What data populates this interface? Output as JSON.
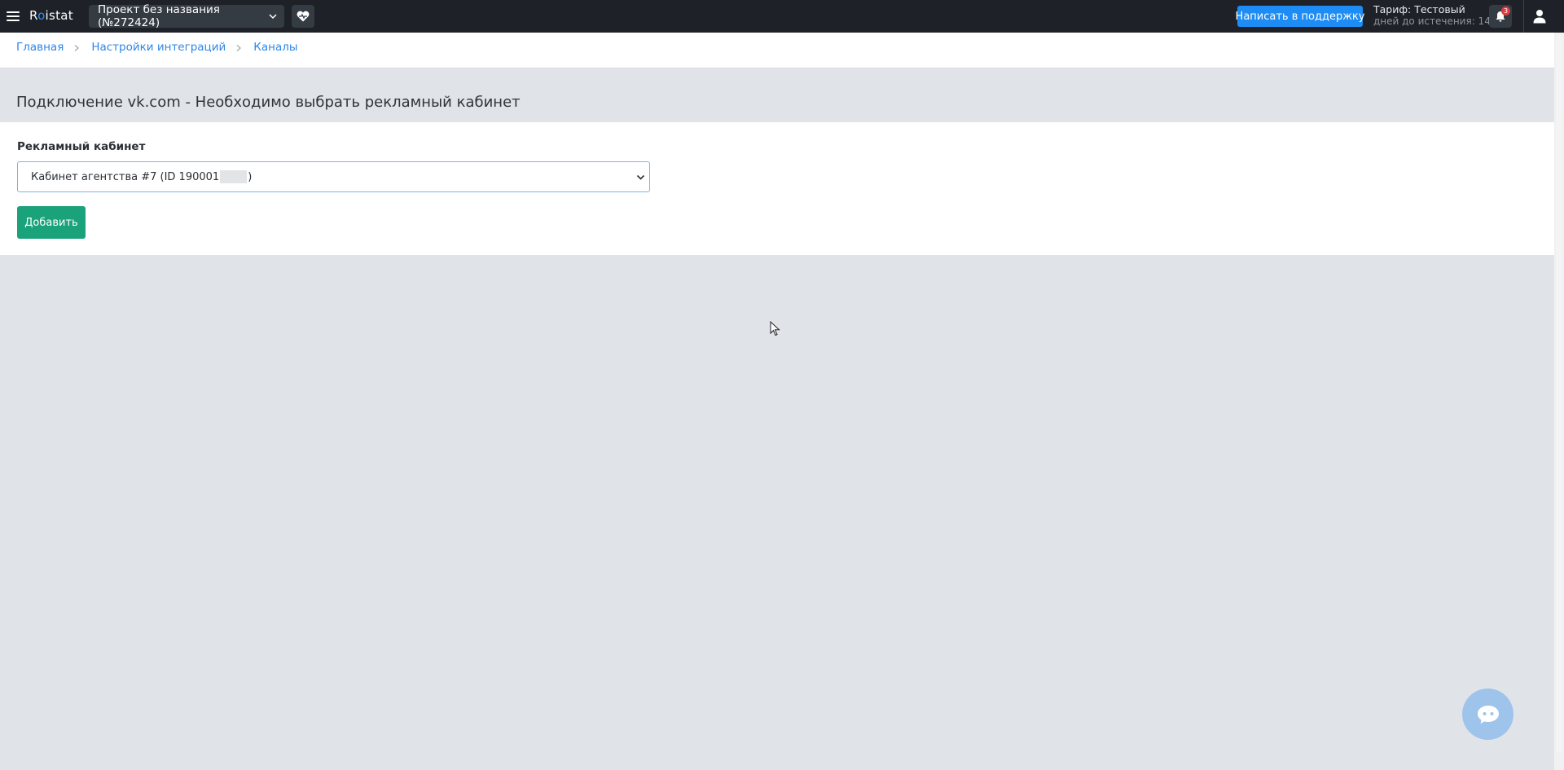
{
  "app": {
    "logo_prefix": "R",
    "logo_dot": "o",
    "logo_suffix": "istat"
  },
  "topbar": {
    "project_label": "Проект без названия (№272424)",
    "support_label": "Написать в поддержку",
    "tariff_line1": "Тариф: Тестовый",
    "tariff_line2": "дней до истечения: 14",
    "notification_count": "3",
    "icons": {
      "menu": "hamburger-menu-icon",
      "project_dropdown": "chevron-down-icon",
      "health": "heart-pulse-icon",
      "notifications": "bell-icon",
      "user": "user-icon"
    }
  },
  "breadcrumb": {
    "items": [
      "Главная",
      "Настройки интеграций",
      "Каналы"
    ]
  },
  "page": {
    "title": "Подключение vk.com - Необходимо выбрать рекламный кабинет"
  },
  "form": {
    "field_label": "Рекламный кабинет",
    "selected_prefix": "Кабинет агентства #7 (ID 190001",
    "selected_suffix": ")",
    "add_button": "Добавить"
  },
  "colors": {
    "topbar_bg": "#1e2228",
    "accent_blue": "#1e8cf5",
    "add_button": "#1aa27a",
    "page_bg": "#e0e4e8",
    "link": "#2f86e8",
    "badge": "#e23b3b"
  }
}
